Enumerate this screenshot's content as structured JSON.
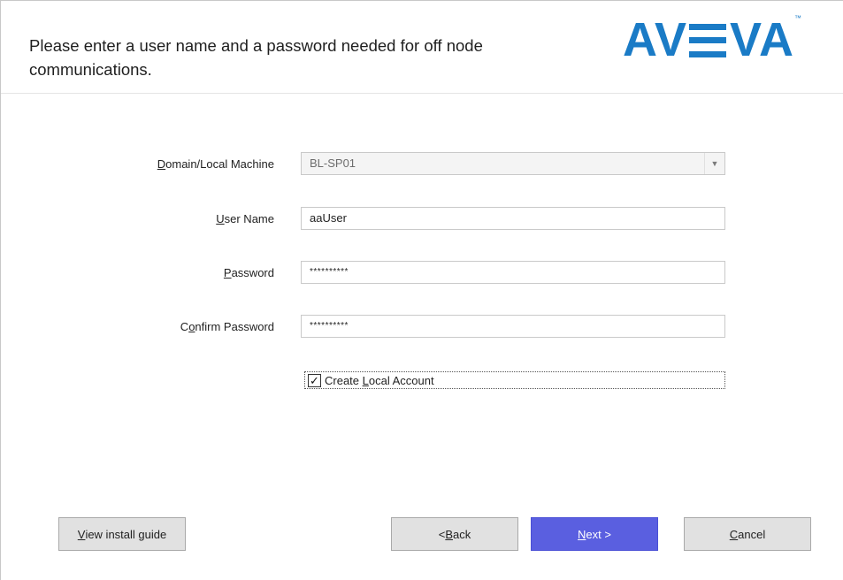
{
  "header": {
    "instruction": "Please enter a user name and a password needed for off node communications.",
    "logo_text_a": "A",
    "logo_text_v": "V",
    "logo_text_va": "VA",
    "logo_tm": "™",
    "logo_color": "#1a7bc6"
  },
  "form": {
    "domain": {
      "label_u": "D",
      "label_rest": "omain/Local Machine",
      "value": "BL-SP01"
    },
    "username": {
      "label_u": "U",
      "label_rest": "ser Name",
      "value": "aaUser"
    },
    "password": {
      "label_u": "P",
      "label_rest": "assword",
      "value": "**********"
    },
    "confirm": {
      "label_pre": "C",
      "label_u": "o",
      "label_rest": "nfirm Password",
      "value": "**********"
    },
    "create_local": {
      "checked": true,
      "check_glyph": "✓",
      "label_pre": "Create ",
      "label_u": "L",
      "label_rest": "ocal Account"
    }
  },
  "buttons": {
    "guide": {
      "u": "V",
      "rest": "iew install guide"
    },
    "back": {
      "pre": "< ",
      "u": "B",
      "rest": "ack"
    },
    "next": {
      "u": "N",
      "rest": "ext >"
    },
    "cancel": {
      "u": "C",
      "rest": "ancel"
    }
  },
  "colors": {
    "primary_button": "#5a5fe0"
  }
}
